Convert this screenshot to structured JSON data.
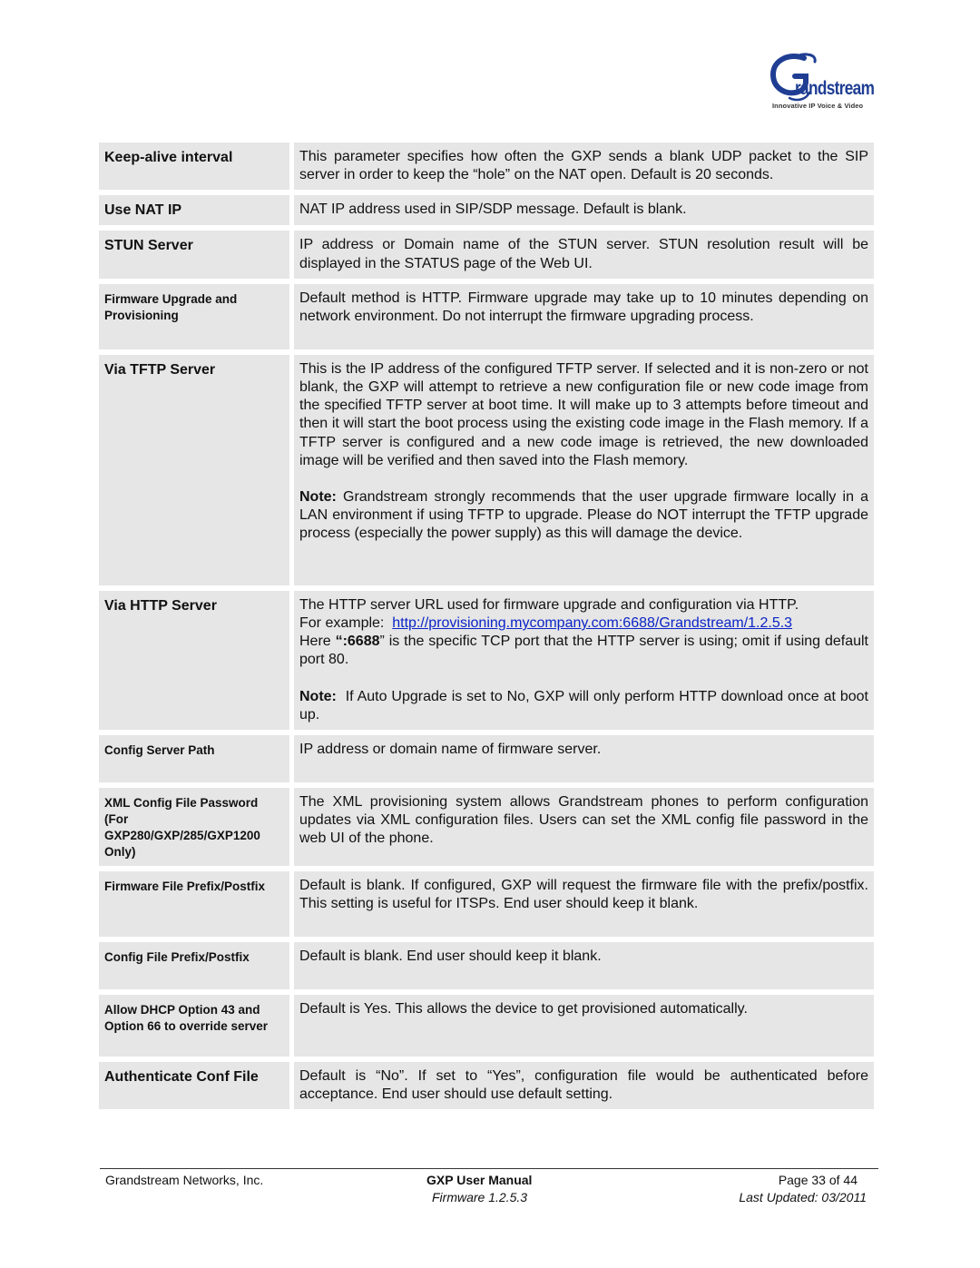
{
  "header": {
    "logo": {
      "brand": "Grandstream",
      "word": "randstream",
      "tagline": "Innovative IP Voice & Video",
      "brand_color": "#1f3e93"
    }
  },
  "rows": [
    {
      "name": "Keep-alive interval",
      "size": "big",
      "desc": [
        "This parameter specifies how often the GXP sends a blank UDP packet to the SIP server in order to keep the “hole” on the NAT open. Default is 20 seconds."
      ]
    },
    {
      "name": "Use NAT IP",
      "size": "big",
      "desc": [
        "NAT IP address used in SIP/SDP message. Default is blank."
      ]
    },
    {
      "name": "STUN Server",
      "size": "big",
      "desc": [
        "IP address or Domain name of the STUN server. STUN resolution result will be displayed in the STATUS page of the Web UI."
      ]
    },
    {
      "name": "Firmware Upgrade and Provisioning",
      "size": "small",
      "desc": [
        "Default method is HTTP.  Firmware upgrade may take up to 10 minutes depending on network environment. Do not interrupt the firmware upgrading process."
      ]
    },
    {
      "name": "Via TFTP Server",
      "size": "big",
      "desc": [
        "This is the IP address of the configured TFTP server. If selected and it is non-zero or not blank, the GXP will attempt to retrieve a new configuration file or new code image from the specified TFTP server at boot time. It will make up to 3 attempts before timeout and then it will start the boot process using the existing code image in the Flash memory. If a TFTP server is configured and a new code image is retrieved, the new downloaded image will be verified and then saved into the Flash memory."
      ],
      "note_label": "Note:",
      "note_text": " Grandstream strongly recommends that the user upgrade firmware locally in a LAN environment if using TFTP to upgrade.  Please do NOT interrupt the TFTP upgrade process (especially the power supply) as this will damage the device."
    },
    {
      "name": "Via HTTP Server",
      "size": "big",
      "http": {
        "line1": "The HTTP server URL used for firmware upgrade and configuration via HTTP.",
        "example_label": "For example:  ",
        "example_url": "http://provisioning.mycompany.com:6688/Grandstream/1.2.5.3",
        "here_prefix": "Here ",
        "port_bold": "“:6688",
        "here_suffix": "” is the specific TCP port that the HTTP server is using; omit if using default port 80.",
        "note_label": "Note:",
        "note_text": "  If Auto Upgrade is set to No, GXP will only perform HTTP download once at boot up."
      }
    },
    {
      "name": "Config Server Path",
      "size": "small",
      "desc": [
        "IP address or domain name of firmware server."
      ]
    },
    {
      "name": "XML Config File Password (For GXP280/GXP/285/GXP1200 Only)",
      "size": "small",
      "desc": [
        "The XML provisioning system allows Grandstream phones to perform configuration updates via XML configuration files. Users can set the XML config file password in the web UI of the phone."
      ]
    },
    {
      "name": "Firmware File Prefix/Postfix",
      "size": "small",
      "desc": [
        "Default is blank. If configured, GXP will request the firmware file with the prefix/postfix.  This setting is useful for ITSPs.  End user should keep it blank."
      ]
    },
    {
      "name": "Config File Prefix/Postfix",
      "size": "small",
      "desc": [
        "Default is blank. End user should keep it blank."
      ]
    },
    {
      "name": "Allow DHCP Option 43 and Option 66 to override server",
      "size": "small",
      "desc": [
        "Default is Yes. This allows the device to get provisioned automatically."
      ]
    },
    {
      "name": "Authenticate Conf File",
      "size": "big",
      "desc": [
        "Default is “No”. If set to “Yes”, configuration file would be authenticated before acceptance. End user should use default setting."
      ]
    }
  ],
  "footer": {
    "company": "Grandstream Networks, Inc.",
    "manual_title": "GXP User Manual",
    "firmware": "Firmware 1.2.5.3",
    "page": "Page 33 of 44",
    "last_updated": "Last Updated: 03/2011"
  }
}
